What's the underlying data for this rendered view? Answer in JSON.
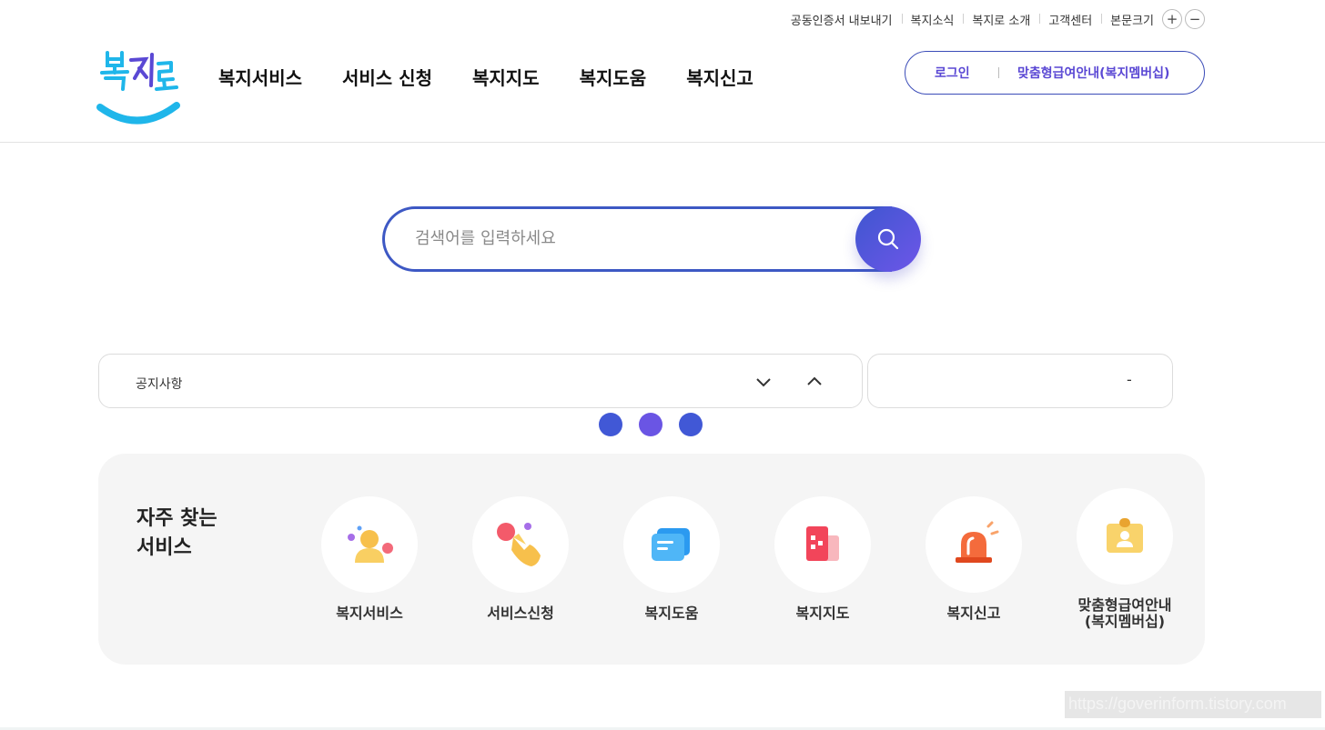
{
  "utility": {
    "links": [
      "공동인증서 내보내기",
      "복지소식",
      "복지로 소개",
      "고객센터"
    ],
    "text_size_label": "본문크기",
    "increase": "+",
    "decrease": "−"
  },
  "header": {
    "logo_text": "복지로",
    "nav": [
      "복지서비스",
      "서비스 신청",
      "복지지도",
      "복지도움",
      "복지신고"
    ],
    "login_label": "로그인",
    "membership_label": "맞춤형급여안내(복지멤버십)"
  },
  "search": {
    "placeholder": "검색어를 입력하세요",
    "value": ""
  },
  "notice": {
    "label": "공지사항",
    "side_text": "-"
  },
  "pagination_dots": 3,
  "favorites": {
    "title_line1": "자주 찾는",
    "title_line2": "서비스",
    "items": [
      {
        "label": "복지서비스",
        "icon": "person-icon"
      },
      {
        "label": "서비스신청",
        "icon": "hand-pointer-icon"
      },
      {
        "label": "복지도움",
        "icon": "chat-icon"
      },
      {
        "label": "복지지도",
        "icon": "map-building-icon"
      },
      {
        "label": "복지신고",
        "icon": "siren-icon"
      },
      {
        "label": "맞춤형급여안내\n(복지멤버십)",
        "icon": "id-badge-icon"
      }
    ]
  },
  "watermark": "https://goverinform.tistory.com",
  "colors": {
    "primary": "#3d58c4",
    "accent_purple": "#6d56e8",
    "logo_blue": "#1fb6ea"
  }
}
